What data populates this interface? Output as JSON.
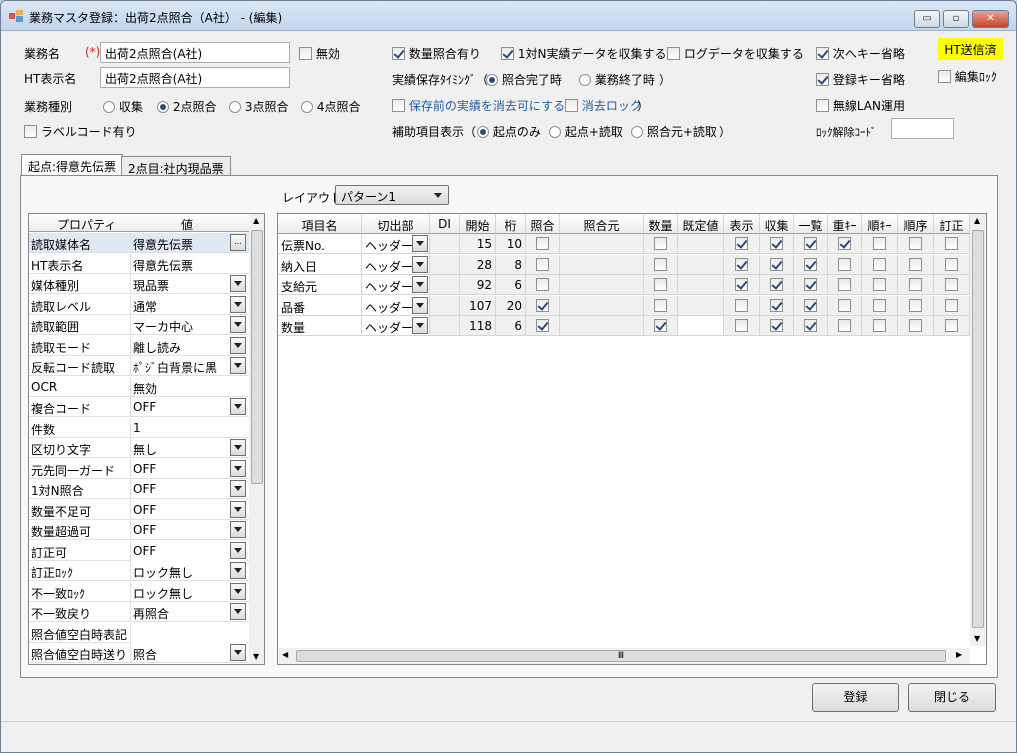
{
  "window": {
    "title": "業務マスタ登録：出荷2点照合（A社） - (編集)",
    "min": "▭",
    "max": "▫",
    "close": "✕"
  },
  "header": {
    "task_name_label": "業務名",
    "required": "(*)",
    "task_name": "出荷2点照合(A社)",
    "invalid_label": "無効",
    "ht_name_label": "HT表示名",
    "ht_name": "出荷2点照合(A社)",
    "task_type_label": "業務種別",
    "task_types": [
      "収集",
      "2点照合",
      "3点照合",
      "4点照合"
    ],
    "task_type_selected": 1,
    "label_code_label": "ラベルコード有り",
    "qty_check_label": "数量照合有り",
    "collect_1n_label": "1対N実績データを収集する",
    "log_label": "ログデータを収集する",
    "save_timing_label": "実績保存ﾀｲﾐﾝｸﾞ（",
    "save_timing_opts": [
      "照合完了時",
      "業務終了時"
    ],
    "save_timing_close": "）",
    "erase_label": "保存前の実績を消去可にする（",
    "erase_lock_label": "消去ロック",
    "erase_close": "）",
    "aux_label": "補助項目表示（",
    "aux_opts": [
      "起点のみ",
      "起点+読取",
      "照合元+読取"
    ],
    "aux_close": "）",
    "next_key_label": "次へキー省略",
    "reg_key_label": "登録キー省略",
    "wlan_label": "無線LAN運用",
    "unlock_label": "ﾛｯｸ解除ｺｰﾄﾞ",
    "ht_sent": "HT送信済",
    "edit_lock_label": "編集ﾛｯｸ"
  },
  "tabs": [
    "起点:得意先伝票",
    "2点目:社内現品票"
  ],
  "layout": {
    "label": "レイアウト:",
    "value": "パターン1"
  },
  "props": {
    "headers": [
      "プロパティ",
      "値"
    ],
    "rows": [
      {
        "name": "読取媒体名",
        "value": "得意先伝票",
        "ctl": "dots"
      },
      {
        "name": "HT表示名",
        "value": "得意先伝票",
        "ctl": ""
      },
      {
        "name": "媒体種別",
        "value": "現品票",
        "ctl": "dd"
      },
      {
        "name": "読取レベル",
        "value": "通常",
        "ctl": "dd"
      },
      {
        "name": "読取範囲",
        "value": "マーカ中心",
        "ctl": "dd"
      },
      {
        "name": "読取モード",
        "value": "離し読み",
        "ctl": "dd"
      },
      {
        "name": "反転コード読取",
        "value": "ﾎﾟｼﾞ白背景に黒",
        "ctl": "dd"
      },
      {
        "name": "OCR",
        "value": "無効",
        "ctl": ""
      },
      {
        "name": "複合コード",
        "value": "OFF",
        "ctl": "dd"
      },
      {
        "name": "  件数",
        "value": "1",
        "ctl": ""
      },
      {
        "name": "  区切り文字",
        "value": "無し",
        "ctl": "dd"
      },
      {
        "name": "元先同一ガード",
        "value": "OFF",
        "ctl": "dd"
      },
      {
        "name": "1対N照合",
        "value": "OFF",
        "ctl": "dd"
      },
      {
        "name": "数量不足可",
        "value": "OFF",
        "ctl": "dd"
      },
      {
        "name": "数量超過可",
        "value": "OFF",
        "ctl": "dd"
      },
      {
        "name": "訂正可",
        "value": "OFF",
        "ctl": "dd",
        "white": true
      },
      {
        "name": "訂正ﾛｯｸ",
        "value": "ロック無し",
        "ctl": "dd"
      },
      {
        "name": "不一致ﾛｯｸ",
        "value": "ロック無し",
        "ctl": "dd"
      },
      {
        "name": "不一致戻り",
        "value": "再照合",
        "ctl": "dd"
      },
      {
        "name": "照合値空白時表記",
        "value": "",
        "ctl": "",
        "white": true
      },
      {
        "name": "照合値空白時送り",
        "value": "照合",
        "ctl": "dd"
      }
    ]
  },
  "grid": {
    "headers": [
      "項目名",
      "切出部",
      "DI",
      "開始",
      "桁",
      "照合",
      "照合元",
      "数量",
      "既定値",
      "表示",
      "収集",
      "一覧",
      "重ｷｰ",
      "順ｷｰ",
      "順序",
      "訂正"
    ],
    "rows": [
      {
        "name": "伝票No.",
        "part": "ヘッダー",
        "di": "",
        "start": "15",
        "len": "10",
        "check": false,
        "qty": false,
        "flags": [
          true,
          true,
          true,
          true,
          false,
          false,
          false
        ]
      },
      {
        "name": "納入日",
        "part": "ヘッダー",
        "di": "",
        "start": "28",
        "len": "8",
        "check": false,
        "qty": false,
        "flags": [
          true,
          true,
          true,
          false,
          false,
          false,
          false
        ]
      },
      {
        "name": "支給元",
        "part": "ヘッダー",
        "di": "",
        "start": "92",
        "len": "6",
        "check": false,
        "qty": false,
        "flags": [
          true,
          true,
          true,
          false,
          false,
          false,
          false
        ]
      },
      {
        "name": "品番",
        "part": "ヘッダー",
        "di": "",
        "start": "107",
        "len": "20",
        "check": true,
        "qty": false,
        "flags": [
          false,
          true,
          true,
          false,
          false,
          false,
          false
        ]
      },
      {
        "name": "数量",
        "part": "ヘッダー",
        "di": "",
        "start": "118",
        "len": "6",
        "check": true,
        "qty": true,
        "flags": [
          false,
          true,
          true,
          false,
          false,
          false,
          false
        ]
      }
    ],
    "scroll_mid": "Ⅲ"
  },
  "buttons": {
    "register": "登録",
    "close": "閉じる"
  }
}
